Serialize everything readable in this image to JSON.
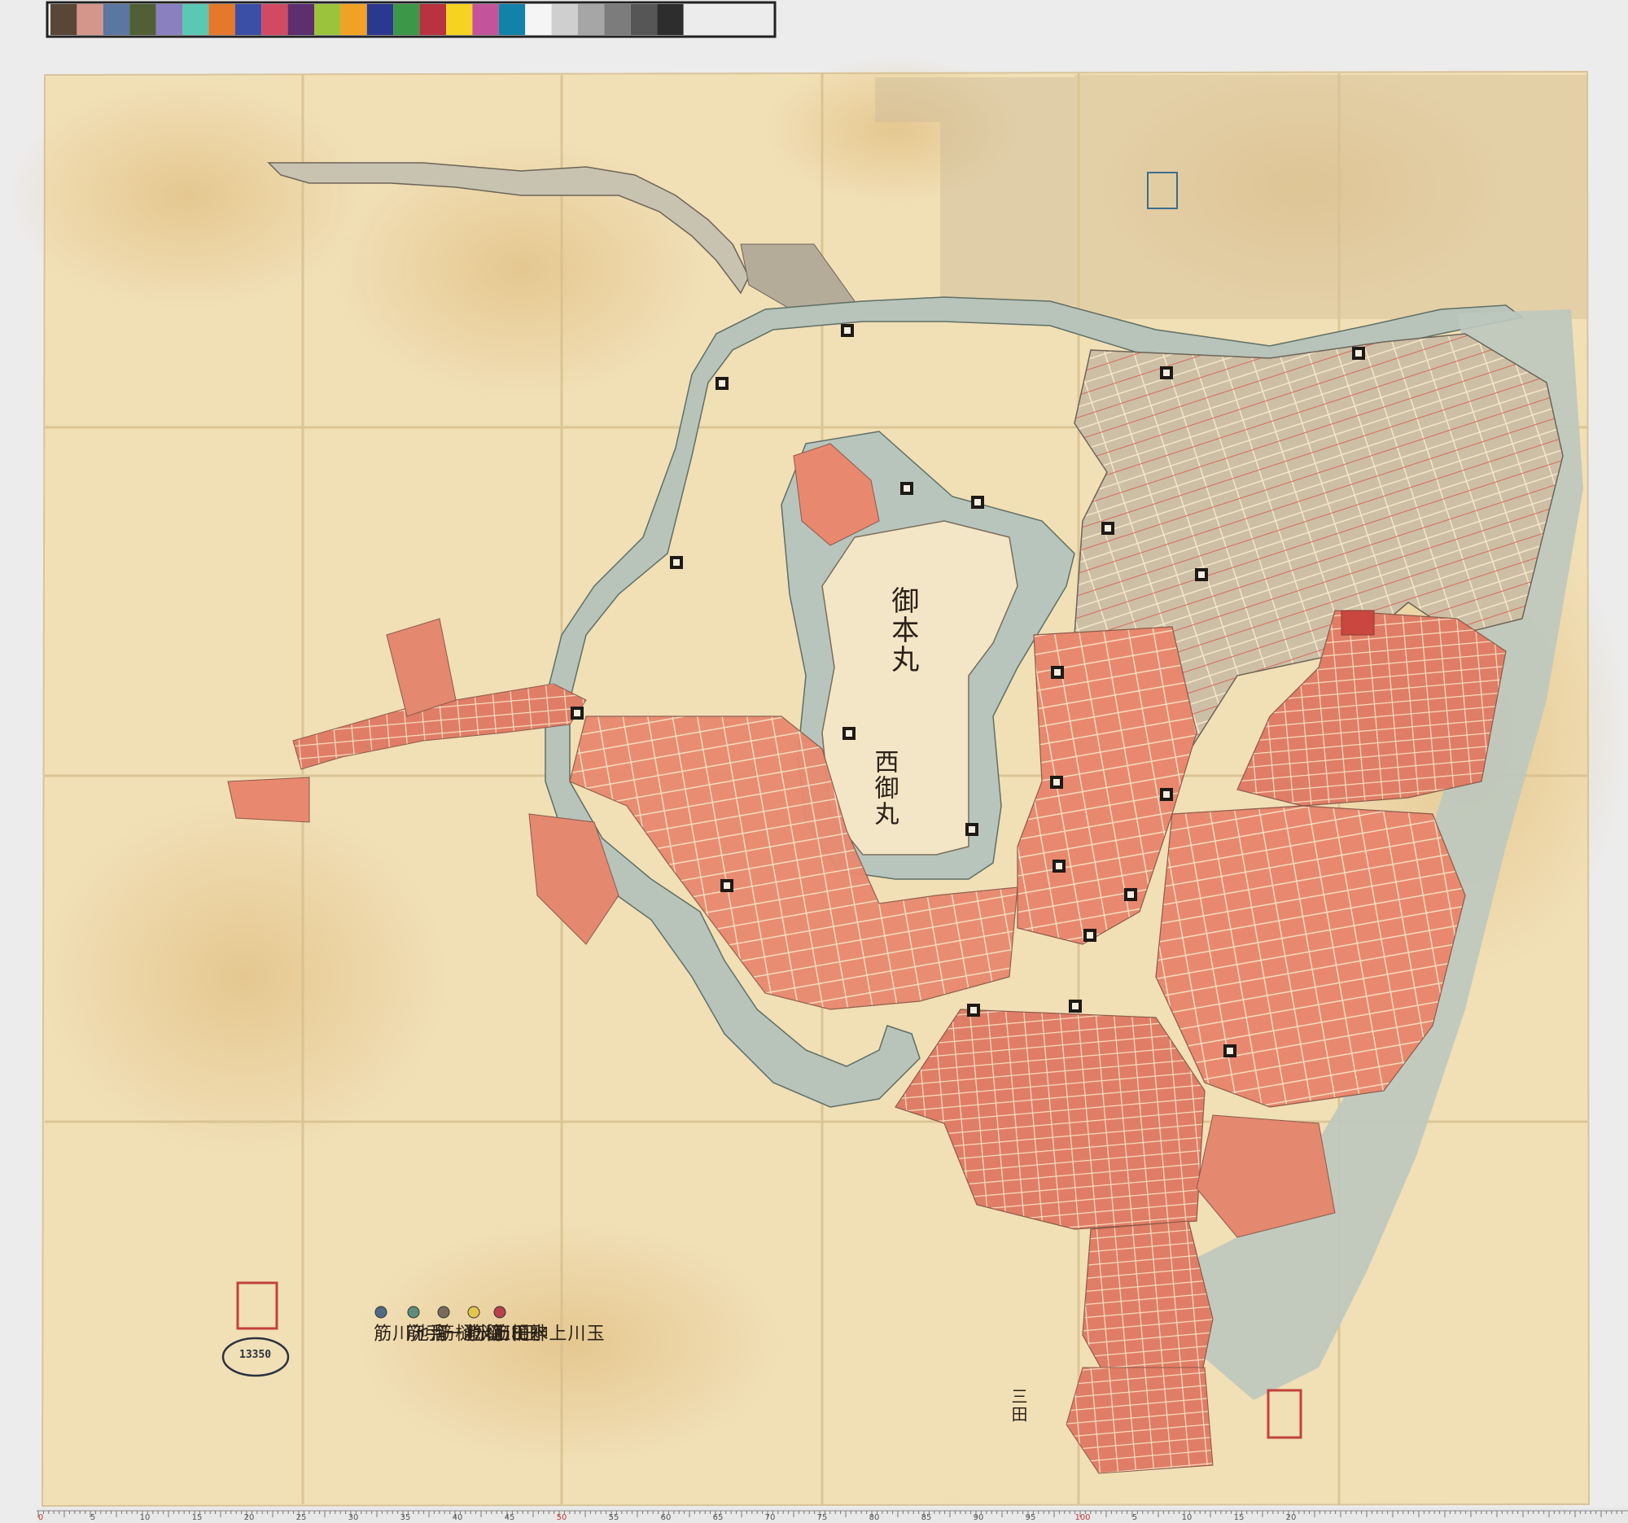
{
  "color_checker": [
    "#5a4636",
    "#d4958a",
    "#5b76a0",
    "#505f35",
    "#8a7fbf",
    "#5bc8b4",
    "#e5782a",
    "#3b4fa7",
    "#d24a62",
    "#5c2f6f",
    "#9cc33c",
    "#f2a127",
    "#2a3890",
    "#3d9748",
    "#b83240",
    "#f6d320",
    "#c4549a",
    "#1283a8",
    "#f5f5f5",
    "#cfcfcf",
    "#a6a6a6",
    "#7c7c7c",
    "#565656",
    "#2d2d2d"
  ],
  "colors": {
    "paper": "#f1dfb6",
    "paper_stain": "#e2c387",
    "moat_water": "#b9c6bc",
    "gray_district": "#c9bca3",
    "red_district": "#e98a72",
    "red_district_dark": "#d9604e",
    "ink": "#2a2118"
  },
  "map": {
    "labels": {
      "honmaru": "御本丸",
      "nishinomaru": "西御丸"
    },
    "legend": [
      {
        "text": "玉川上水樋筋",
        "color": "#b8414c"
      },
      {
        "text": "玉川樋筋",
        "color": "#e3c54a"
      },
      {
        "text": "神田上水樋筋",
        "color": "#7a6a5a"
      },
      {
        "text": "溜池一手筋",
        "color": "#5f8c7a"
      },
      {
        "text": "溜池川筋",
        "color": "#4f6a86"
      }
    ],
    "stamp_number": "13350",
    "bottom_labels": [
      "三田"
    ]
  },
  "ruler": {
    "ticks": [
      "0",
      "5",
      "10",
      "15",
      "20",
      "25",
      "30",
      "35",
      "40",
      "45",
      "50",
      "55",
      "60",
      "65",
      "70",
      "75",
      "80",
      "85",
      "90",
      "95",
      "100",
      "5",
      "10",
      "15",
      "20"
    ]
  }
}
